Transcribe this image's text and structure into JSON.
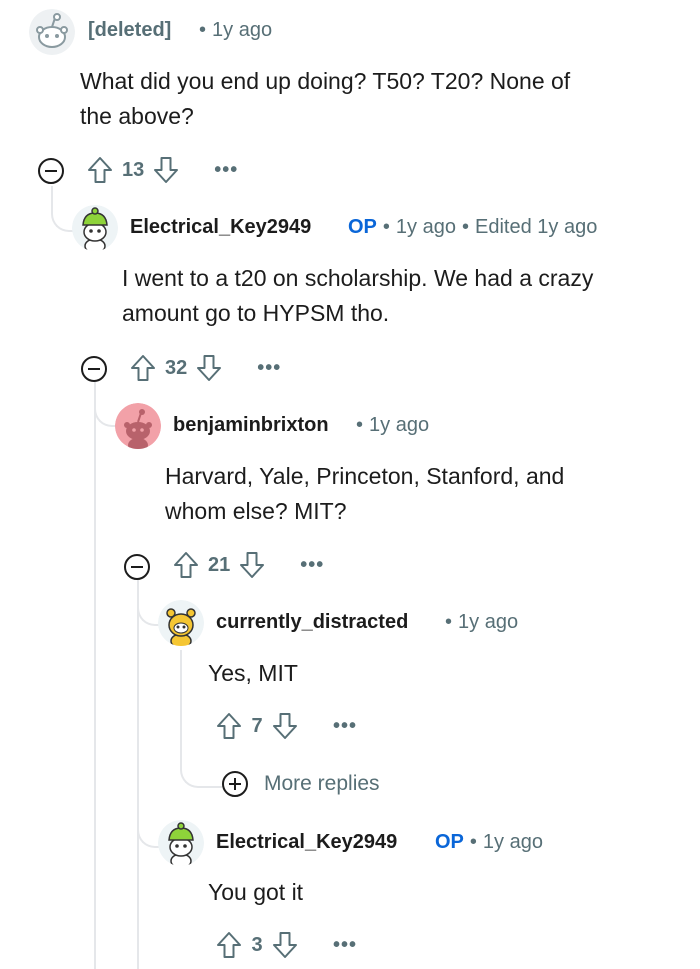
{
  "comments": [
    {
      "username": "[deleted]",
      "op": "",
      "time": "1y ago",
      "edited": "",
      "body_lines": [
        "What did you end up doing? T50? T20? None of",
        "the above?"
      ],
      "score": "13",
      "more_icon": "..."
    },
    {
      "username": "Electrical_Key2949",
      "op": "OP",
      "time": "1y ago",
      "edited": "Edited 1y ago",
      "body_lines": [
        "I went to a t20 on scholarship. We had a crazy",
        "amount go to HYPSM tho."
      ],
      "score": "32",
      "more_icon": "..."
    },
    {
      "username": "benjaminbrixton",
      "op": "",
      "time": "1y ago",
      "edited": "",
      "body_lines": [
        "Harvard, Yale, Princeton, Stanford, and",
        "whom else? MIT?"
      ],
      "score": "21",
      "more_icon": "..."
    },
    {
      "username": "currently_distracted",
      "op": "",
      "time": "1y ago",
      "edited": "",
      "body_lines": [
        "Yes, MIT"
      ],
      "score": "7",
      "more_icon": "..."
    },
    {
      "username": "Electrical_Key2949",
      "op": "OP",
      "time": "1y ago",
      "edited": "",
      "body_lines": [
        "You got it"
      ],
      "score": "3",
      "more_icon": "..."
    }
  ],
  "more_replies": {
    "label": "More replies"
  },
  "separator": "•",
  "colors": {
    "text": "#1c1c1c",
    "meta": "#576f76",
    "op_badge": "#0a66d8",
    "thread_line": "#e5e7ea",
    "avatar_green": "#8ed33a",
    "avatar_pink": "#f2a1a8",
    "avatar_yellow": "#f5c633"
  },
  "icons": {
    "avatar_deleted": "deleted-user-avatar-icon",
    "avatar_snoo_green": "snoo-green-hat-avatar-icon",
    "avatar_snoo_red": "snoo-red-avatar-icon",
    "avatar_snoo_yellow": "snoo-yellow-costume-avatar-icon",
    "upvote": "upvote-arrow-icon",
    "downvote": "downvote-arrow-icon",
    "collapse": "collapse-minus-icon",
    "expand": "plus-circle-icon"
  }
}
